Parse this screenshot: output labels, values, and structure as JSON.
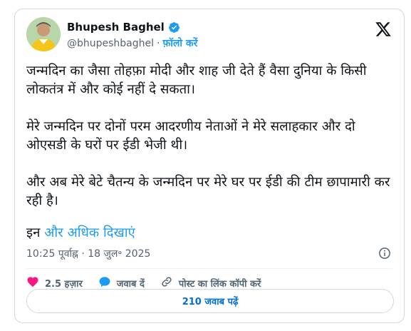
{
  "author": {
    "name": "Bhupesh Baghel",
    "handle": "@bhupeshbaghel",
    "separator": "·",
    "follow_label": "फ़ॉलो करें"
  },
  "tweet": {
    "paragraphs": [
      "जन्मदिन का जैसा तोहफ़ा मोदी और शाह जी देते हैं वैसा दुनिया के किसी लोकतंत्र में और कोई नहीं दे सकता।",
      "मेरे जन्मदिन पर दोनों परम आदरणीय नेताओं ने मेरे सलाहकार और दो ओएसडी के घरों पर ईडी भेजी थी।",
      "और अब मेरे बेटे चैतन्य के जन्मदिन पर मेरे घर पर ईडी की टीम छापामारी कर रही है।"
    ],
    "more_prefix": "इन ",
    "more_link": "और अधिक दिखाएं",
    "timestamp": "10:25 पूर्वाह्न · 18 जुल॰ 2025"
  },
  "actions": {
    "likes": "2.5 हज़ार",
    "reply": "जवाब दें",
    "copy_link": "पोस्ट का लिंक कॉपी करें"
  },
  "read_replies": "210 जवाब पढ़ें",
  "colors": {
    "accent": "#1d9bf0",
    "like": "#f91880",
    "border": "#cfd9de"
  },
  "icons": [
    "verified-icon",
    "x-logo-icon",
    "info-icon",
    "heart-icon",
    "reply-bubble-icon",
    "link-icon"
  ]
}
